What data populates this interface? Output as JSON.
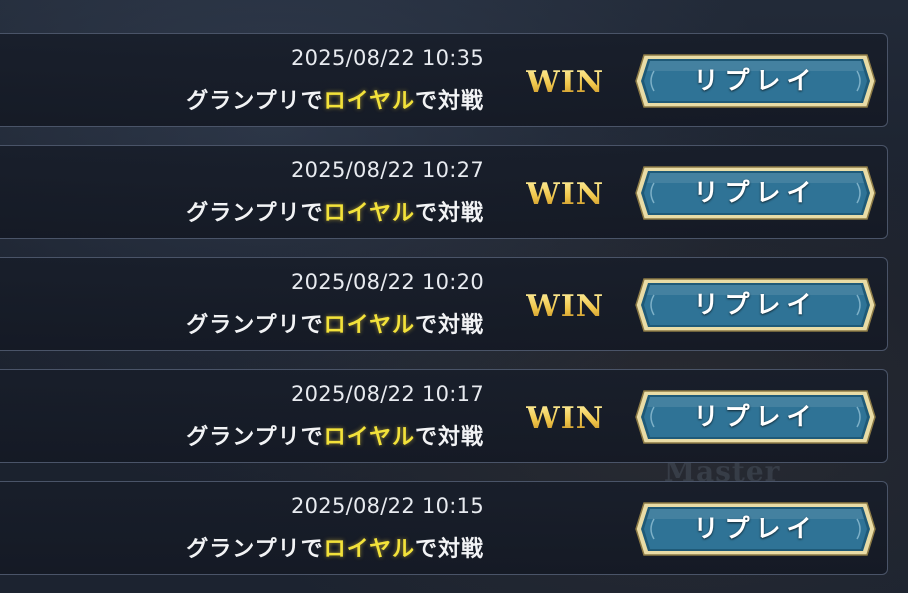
{
  "background": {
    "watermark": "Master"
  },
  "colors": {
    "win_gold": "#f4d35a",
    "highlight_yellow": "#f3e23a",
    "button_blue": "#2b6d8f",
    "button_border_gold": "#d9c27a"
  },
  "history": [
    {
      "datetime": "2025/08/22 10:35",
      "desc_prefix": "グランプリで",
      "desc_highlight": "ロイヤル",
      "desc_suffix": "で対戦",
      "result": "WIN",
      "replay_label": "リプレイ"
    },
    {
      "datetime": "2025/08/22 10:27",
      "desc_prefix": "グランプリで",
      "desc_highlight": "ロイヤル",
      "desc_suffix": "で対戦",
      "result": "WIN",
      "replay_label": "リプレイ"
    },
    {
      "datetime": "2025/08/22 10:20",
      "desc_prefix": "グランプリで",
      "desc_highlight": "ロイヤル",
      "desc_suffix": "で対戦",
      "result": "WIN",
      "replay_label": "リプレイ"
    },
    {
      "datetime": "2025/08/22 10:17",
      "desc_prefix": "グランプリで",
      "desc_highlight": "ロイヤル",
      "desc_suffix": "で対戦",
      "result": "WIN",
      "replay_label": "リプレイ"
    },
    {
      "datetime": "2025/08/22 10:15",
      "desc_prefix": "グランプリで",
      "desc_highlight": "ロイヤル",
      "desc_suffix": "で対戦",
      "result": "",
      "replay_label": "リプレイ"
    }
  ]
}
